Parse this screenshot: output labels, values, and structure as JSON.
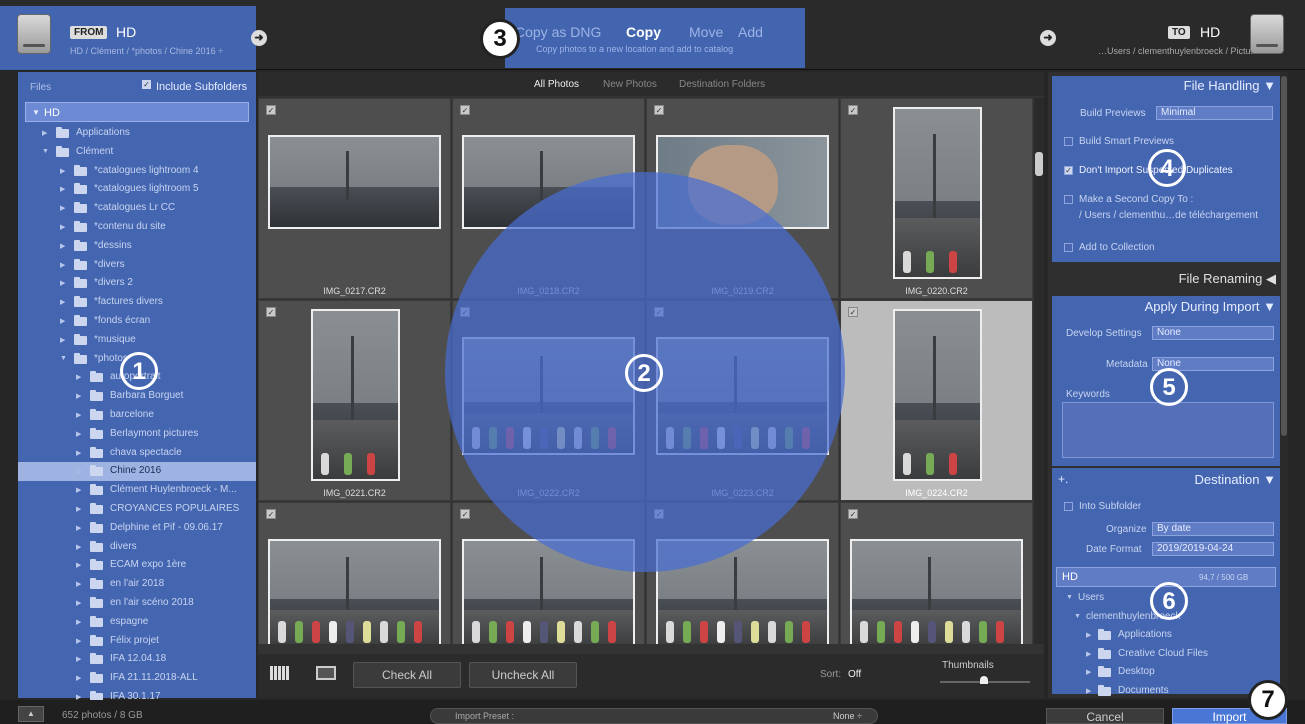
{
  "source": {
    "from_tag": "FROM",
    "name": "HD",
    "path": "HD / Clément / *photos / Chine 2016 ÷"
  },
  "modes": {
    "dng": "Copy as DNG",
    "copy": "Copy",
    "move": "Move",
    "add": "Add",
    "description": "Copy photos to a new location and add to catalog"
  },
  "dest": {
    "to_tag": "TO",
    "name": "HD",
    "path": "…Users / clementhuylenbroeck / Pictures"
  },
  "left": {
    "title": "Files",
    "include_subfolders": "Include Subfolders",
    "volume": "HD",
    "items": [
      {
        "label": "Applications",
        "level": 1,
        "expanded": false
      },
      {
        "label": "Clément",
        "level": 1,
        "expanded": true
      },
      {
        "label": "*catalogues lightroom 4",
        "level": 2
      },
      {
        "label": "*catalogues lightroom 5",
        "level": 2
      },
      {
        "label": "*catalogues Lr CC",
        "level": 2
      },
      {
        "label": "*contenu du site",
        "level": 2
      },
      {
        "label": "*dessins",
        "level": 2
      },
      {
        "label": "*divers",
        "level": 2
      },
      {
        "label": "*divers 2",
        "level": 2
      },
      {
        "label": "*factures divers",
        "level": 2
      },
      {
        "label": "*fonds écran",
        "level": 2
      },
      {
        "label": "*musique",
        "level": 2
      },
      {
        "label": "*photos",
        "level": 2,
        "expanded": true
      },
      {
        "label": "autoportrait",
        "level": 3
      },
      {
        "label": "Barbara Borguet",
        "level": 3
      },
      {
        "label": "barcelone",
        "level": 3
      },
      {
        "label": "Berlaymont pictures",
        "level": 3
      },
      {
        "label": "chava spectacle",
        "level": 3
      },
      {
        "label": "Chine 2016",
        "level": 3,
        "selected": true
      },
      {
        "label": "Clément Huylenbroeck - M...",
        "level": 3
      },
      {
        "label": "CROYANCES POPULAIRES",
        "level": 3
      },
      {
        "label": "Delphine et Pif - 09.06.17",
        "level": 3
      },
      {
        "label": "divers",
        "level": 3
      },
      {
        "label": "ECAM expo 1ère",
        "level": 3
      },
      {
        "label": "en l'air 2018",
        "level": 3
      },
      {
        "label": "en l'air scéno 2018",
        "level": 3
      },
      {
        "label": "espagne",
        "level": 3
      },
      {
        "label": "Félix projet",
        "level": 3
      },
      {
        "label": "IFA 12.04.18",
        "level": 3
      },
      {
        "label": "IFA 21.11.2018-ALL",
        "level": 3
      },
      {
        "label": "IFA 30.1.17",
        "level": 3
      }
    ]
  },
  "tabs": {
    "all": "All Photos",
    "new": "New Photos",
    "dest": "Destination Folders"
  },
  "photos": [
    "IMG_0217.CR2",
    "IMG_0218.CR2",
    "IMG_0219.CR2",
    "IMG_0220.CR2",
    "IMG_0221.CR2",
    "IMG_0222.CR2",
    "IMG_0223.CR2",
    "IMG_0224.CR2"
  ],
  "toolbar": {
    "check_all": "Check All",
    "uncheck_all": "Uncheck All",
    "sort_label": "Sort:",
    "sort_value": "Off",
    "thumbnails": "Thumbnails"
  },
  "right": {
    "file_handling": "File Handling",
    "build_previews_label": "Build Previews",
    "build_previews_value": "Minimal",
    "smart_previews": "Build Smart Previews",
    "dont_import": "Don't Import Suspected Duplicates",
    "second_copy": "Make a Second Copy To :",
    "second_copy_path": "/ Users / clementhu…de téléchargement",
    "add_collection": "Add to Collection",
    "file_renaming": "File Renaming",
    "apply_during": "Apply During Import",
    "develop_label": "Develop Settings",
    "develop_value": "None",
    "metadata_label": "Metadata",
    "metadata_value": "None",
    "keywords": "Keywords",
    "destination": "Destination",
    "into_subfolder": "Into Subfolder",
    "organize_label": "Organize",
    "organize_value": "By date",
    "date_label": "Date Format",
    "date_value": "2019/2019-04-24",
    "volume": "HD",
    "volume_size": "94,7 / 500 GB",
    "tree": [
      "Users",
      "clementhuylenbroeck",
      "Applications",
      "Creative Cloud Files",
      "Desktop",
      "Documents"
    ]
  },
  "bottom": {
    "count": "652 photos / 8 GB",
    "preset": "Import Preset :",
    "preset_value": "None ÷",
    "cancel": "Cancel",
    "import": "Import"
  },
  "markers": [
    "1",
    "2",
    "3",
    "4",
    "5",
    "6",
    "7"
  ],
  "colors": {
    "highlight": "#4a76d6",
    "background": "#262626"
  }
}
